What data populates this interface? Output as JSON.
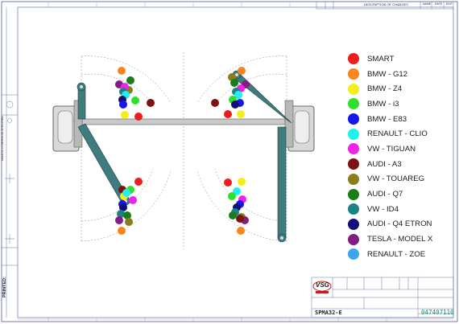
{
  "legend": [
    {
      "label": "SMART",
      "color": "#ee1c1c"
    },
    {
      "label": "BMW - G12",
      "color": "#f7861d"
    },
    {
      "label": "BMW - Z4",
      "color": "#f4ee1a"
    },
    {
      "label": "BMW - i3",
      "color": "#2ee02e"
    },
    {
      "label": "BMW - E83",
      "color": "#1616e8"
    },
    {
      "label": "RENAULT - CLIO",
      "color": "#1ff2ee"
    },
    {
      "label": "VW - TIGUAN",
      "color": "#ef23e6"
    },
    {
      "label": "AUDI - A3",
      "color": "#7e1212"
    },
    {
      "label": "VW - TOUAREG",
      "color": "#8a7d1a"
    },
    {
      "label": "AUDI - Q7",
      "color": "#197d19"
    },
    {
      "label": "VW - ID4",
      "color": "#1a8286"
    },
    {
      "label": "AUDI - Q4 ETRON",
      "color": "#101078"
    },
    {
      "label": "TESLA - MODEL X",
      "color": "#851c85"
    },
    {
      "label": "RENAULT - ZOE",
      "color": "#3ba6ef"
    }
  ],
  "header": {
    "description_label": "DESCRIPTION OF CHANGES",
    "name_label": "NAME",
    "date_label": "DATE",
    "edit_label": "EDIT"
  },
  "left_margin": {
    "text_1": "UNLESS OTHERWISE SPECIFIED",
    "printed_label": "PRINTED:"
  },
  "title_block": {
    "logo_text": "VSG",
    "drawing_number": "SPMA32-E",
    "part_number": "047407110"
  }
}
